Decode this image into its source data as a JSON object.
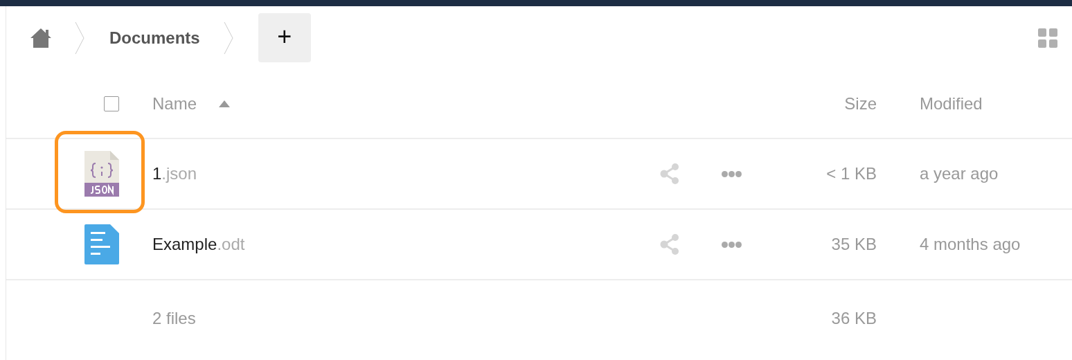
{
  "breadcrumb": {
    "items": [
      {
        "kind": "home"
      },
      {
        "kind": "folder",
        "label": "Documents"
      }
    ],
    "new_button": "+"
  },
  "view_toggle": {
    "kind": "grid"
  },
  "table": {
    "select_all": {
      "checked": false
    },
    "columns": [
      {
        "label": "Name",
        "sorted_ascending": true
      },
      {
        "label": "Size"
      },
      {
        "label": "Modified"
      }
    ],
    "rows": [
      {
        "kind": "json",
        "name": "1",
        "extension": ".json",
        "size": "< 1 KB",
        "modified": "a year ago",
        "highlighted": true
      },
      {
        "kind": "document",
        "name": "Example",
        "extension": ".odt",
        "size": "35 KB",
        "modified": "4 months ago",
        "highlighted": false
      }
    ],
    "summary": {
      "files": "2 files",
      "size": "36 KB"
    }
  }
}
